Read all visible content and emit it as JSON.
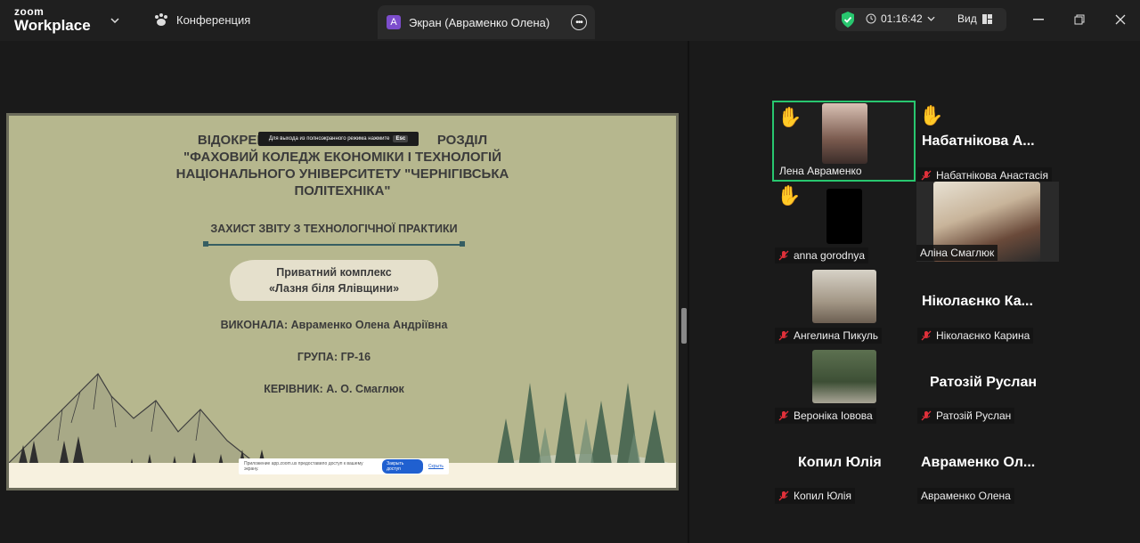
{
  "app": {
    "brand_top": "zoom",
    "brand_bottom": "Workplace"
  },
  "tabs": {
    "conference": "Конференция",
    "screen": "Экран (Авраменко Олена)",
    "screen_avatar": "A"
  },
  "status": {
    "timer": "01:16:42",
    "view": "Вид"
  },
  "slide": {
    "title_lines": [
      "ВІДОКРЕМ",
      "РОЗДІЛ",
      "\"ФАХОВИЙ КОЛЕДЖ ЕКОНОМІКИ І ТЕХНОЛОГІЙ",
      "НАЦІОНАЛЬНОГО УНІВЕРСИТЕТУ \"ЧЕРНІГІВСЬКА",
      "ПОЛІТЕХНІКА\""
    ],
    "esc_text": "Для выхода из полноэкранного режима нажмите",
    "esc_key": "Esc",
    "subtitle": "ЗАХИСТ ЗВІТУ З ТЕХНОЛОГІЧНОЇ ПРАКТИКИ",
    "cloud_line1": "Приватний комплекс",
    "cloud_line2": "«Лазня біля Ялівщини»",
    "author": "ВИКОНАЛА: Авраменко Олена Андріївна",
    "group": "ГРУПА: ГР-16",
    "supervisor": "КЕРІВНИК: А. О. Смаглюк",
    "notification": {
      "text": "Приложение app.zoom.us предоставило доступ к вашему экрану.",
      "button": "Закрыть доступ",
      "link": "Скрыть"
    }
  },
  "participants": [
    {
      "name": "Лена Авраменко",
      "hand": "✋"
    },
    {
      "name": "Набатнікова Анастасія",
      "big": "Набатнікова А...",
      "hand": "✋"
    },
    {
      "name": "anna gorodnya",
      "hand": "✋"
    },
    {
      "name": "Аліна Смаглюк"
    },
    {
      "name": "Ангелина Пикуль"
    },
    {
      "name": "Ніколаєнко Карина",
      "big": "Ніколаєнко Ка..."
    },
    {
      "name": "Вероніка Іовова"
    },
    {
      "name": "Ратозій Руслан",
      "big": "Ратозій Руслан"
    },
    {
      "name": "Копил Юлія",
      "big": "Копил Юлія"
    },
    {
      "name": "Авраменко Олена",
      "big": "Авраменко Ол..."
    }
  ],
  "colors": {
    "active_border": "#28c76f",
    "slide_bg": "#b6b78e",
    "accent": "#2060d0",
    "mute": "#e0303a"
  }
}
